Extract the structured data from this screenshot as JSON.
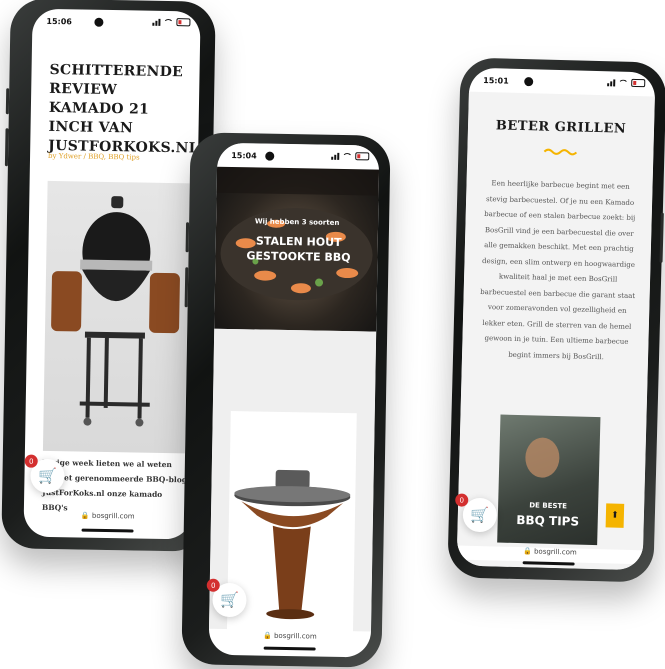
{
  "phone_left": {
    "time": "15:06",
    "title": "SCHITTERENDE REVIEW KAMADO 21 INCH VAN JUSTFORKOKS.NL",
    "meta": "by Ydwer / BBQ, BBQ tips",
    "body_text": "Vorige week lieten we al weten dat het gerenommeerde BBQ-blog JustForKoks.nl onze kamado BBQ's",
    "cart_badge": "0",
    "url": "bosgrill.com"
  },
  "phone_middle": {
    "time": "15:04",
    "hero_subtitle": "Wij hebben 3 soorten",
    "hero_title": "STALEN HOUT GESTOOKTE BBQ",
    "cart_badge": "0",
    "url": "bosgrill.com"
  },
  "phone_right": {
    "time": "15:01",
    "heading": "BETER GRILLEN",
    "paragraph": "Een heerlijke barbecue begint met een stevig barbecuestel. Of je nu een Kamado barbecue of een stalen barbecue zoekt: bij BosGrill vind je een barbecuestel die over alle gemakken beschikt. Met een prachtig design, een slim ontwerp en hoogwaardige kwaliteit haal je met een BosGrill barbecuestel een barbecue die garant staat voor zomeravonden vol gezelligheid en lekker eten. Grill de sterren van de hemel gewoon in je tuin. Een ultieme barbecue begint immers bij BosGrill.",
    "card_kicker": "DE BESTE",
    "card_title": "BBQ TIPS",
    "cart_badge": "0",
    "url": "bosgrill.com"
  },
  "colors": {
    "accent": "#f5b400",
    "accent_text": "#e0a22a",
    "heading": "#1a1a1a",
    "body": "#555555",
    "badge": "#d32f2f"
  },
  "icons": [
    "cart-icon",
    "lock-icon",
    "arrow-up-icon",
    "wifi-icon",
    "battery-icon",
    "signal-icon"
  ]
}
